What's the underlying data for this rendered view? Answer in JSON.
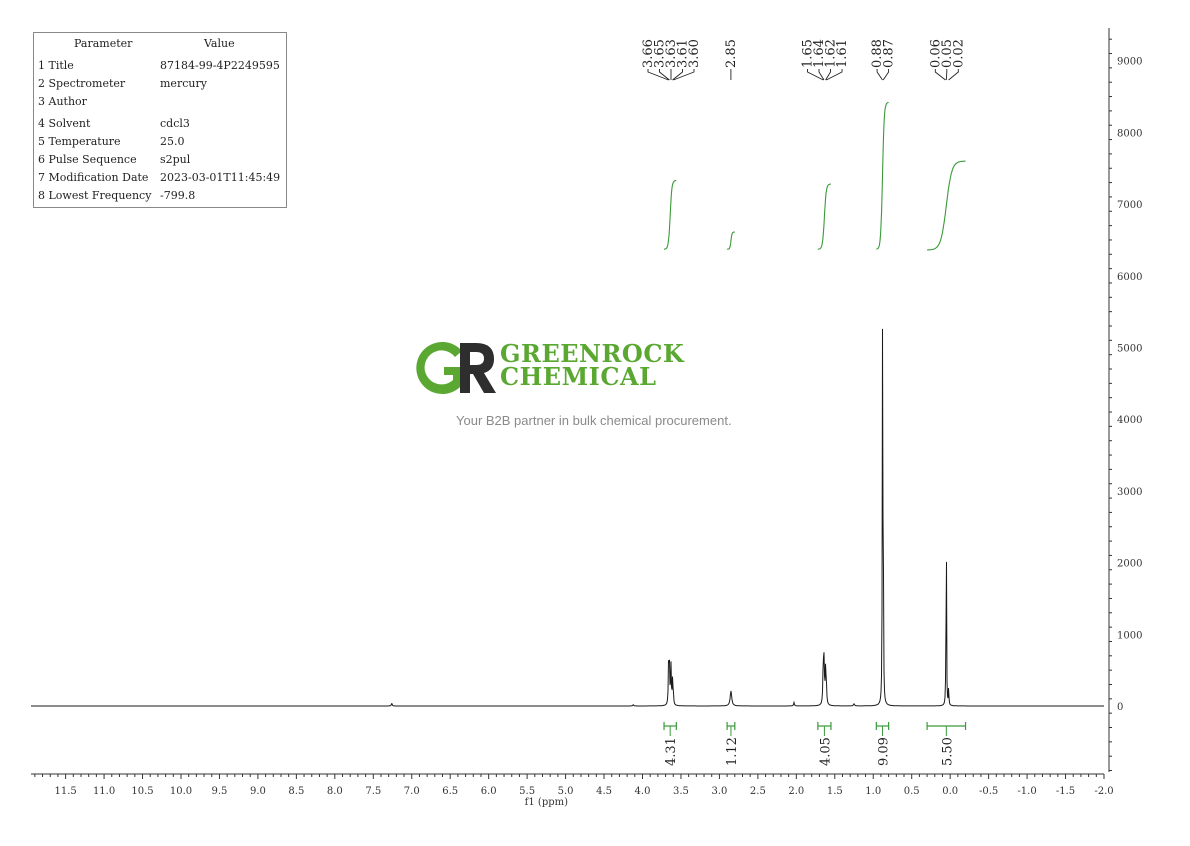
{
  "parameters": {
    "header": {
      "param": "Parameter",
      "value": "Value"
    },
    "rows": [
      {
        "label": "1 Title",
        "value": "87184-99-4P2249595"
      },
      {
        "label": "2 Spectrometer",
        "value": "mercury"
      },
      {
        "label": "3 Author",
        "value": ""
      },
      {
        "label": "4 Solvent",
        "value": "cdcl3"
      },
      {
        "label": "5 Temperature",
        "value": "25.0"
      },
      {
        "label": "6 Pulse Sequence",
        "value": "s2pul"
      },
      {
        "label": "7 Modification Date",
        "value": "2023-03-01T11:45:49"
      },
      {
        "label": "8 Lowest Frequency",
        "value": "-799.8"
      }
    ]
  },
  "watermark": {
    "brand_line1": "GREENROCK",
    "brand_line2": "CHEMICAL",
    "tagline": "Your B2B partner in bulk chemical procurement.",
    "color": "#5aa832",
    "dark_color": "#2e2e2e"
  },
  "chart_data": {
    "type": "line",
    "xlabel": "f1 (ppm)",
    "xlim": [
      11.95,
      -2.0
    ],
    "x_reversed": true,
    "x_ticks": [
      "11.5",
      "11.0",
      "10.5",
      "10.0",
      "9.5",
      "9.0",
      "8.5",
      "8.0",
      "7.5",
      "7.0",
      "6.5",
      "6.0",
      "5.5",
      "5.0",
      "4.5",
      "4.0",
      "3.5",
      "3.0",
      "2.5",
      "2.0",
      "1.5",
      "1.0",
      "0.5",
      "0.0",
      "-0.5",
      "-1.0",
      "-1.5",
      "-2.0"
    ],
    "y_right_ticks": [
      "9000",
      "8000",
      "7000",
      "6000",
      "5000",
      "4000",
      "3000",
      "2000",
      "1000",
      "0"
    ],
    "ylim": [
      -930,
      9450
    ],
    "peaks": [
      {
        "ppm": 7.26,
        "height": 40,
        "width": 0.006
      },
      {
        "ppm": 4.12,
        "height": 20,
        "width": 0.006
      },
      {
        "ppm": 3.66,
        "height": 620,
        "width": 0.005
      },
      {
        "ppm": 3.65,
        "height": 520,
        "width": 0.005
      },
      {
        "ppm": 3.63,
        "height": 560,
        "width": 0.005
      },
      {
        "ppm": 3.61,
        "height": 330,
        "width": 0.005
      },
      {
        "ppm": 3.6,
        "height": 170,
        "width": 0.005
      },
      {
        "ppm": 2.85,
        "height": 210,
        "width": 0.012
      },
      {
        "ppm": 2.03,
        "height": 50,
        "width": 0.006
      },
      {
        "ppm": 1.65,
        "height": 520,
        "width": 0.006
      },
      {
        "ppm": 1.64,
        "height": 560,
        "width": 0.006
      },
      {
        "ppm": 1.62,
        "height": 470,
        "width": 0.006
      },
      {
        "ppm": 1.61,
        "height": 230,
        "width": 0.006
      },
      {
        "ppm": 1.25,
        "height": 30,
        "width": 0.008
      },
      {
        "ppm": 0.88,
        "height": 4960,
        "width": 0.0035
      },
      {
        "ppm": 0.87,
        "height": 2900,
        "width": 0.0035
      },
      {
        "ppm": 0.06,
        "height": 120,
        "width": 0.004
      },
      {
        "ppm": 0.05,
        "height": 3220,
        "width": 0.003
      },
      {
        "ppm": 0.02,
        "height": 250,
        "width": 0.004
      }
    ],
    "peak_labels": [
      {
        "group": [
          3.66,
          3.65,
          3.63,
          3.61,
          3.6
        ],
        "labels": [
          "3.66",
          "3.65",
          "3.63",
          "3.61",
          "3.60"
        ]
      },
      {
        "group": [
          2.85
        ],
        "labels": [
          "2.85"
        ]
      },
      {
        "group": [
          1.65,
          1.64,
          1.62,
          1.61
        ],
        "labels": [
          "1.65",
          "1.64",
          "1.62",
          "1.61"
        ]
      },
      {
        "group": [
          0.88,
          0.87
        ],
        "labels": [
          "0.88",
          "0.87"
        ]
      },
      {
        "group": [
          0.06,
          0.05,
          0.02
        ],
        "labels": [
          "0.06",
          "0.05",
          "0.02"
        ]
      }
    ],
    "integrals": [
      {
        "from": 3.72,
        "to": 3.56,
        "value": "4.31",
        "curve_start": 6370,
        "curve_end": 7330
      },
      {
        "from": 2.9,
        "to": 2.8,
        "value": "1.12",
        "curve_start": 6370,
        "curve_end": 6610
      },
      {
        "from": 1.72,
        "to": 1.55,
        "value": "4.05",
        "curve_start": 6370,
        "curve_end": 7280
      },
      {
        "from": 0.96,
        "to": 0.8,
        "value": "9.09",
        "curve_start": 6370,
        "curve_end": 8420
      },
      {
        "from": 0.3,
        "to": -0.2,
        "value": "5.50",
        "curve_start": 6360,
        "curve_end": 7600
      }
    ],
    "colors": {
      "spectrum": "#1a1a1a",
      "integral": "#3a9a3a",
      "axis": "#333333"
    }
  }
}
